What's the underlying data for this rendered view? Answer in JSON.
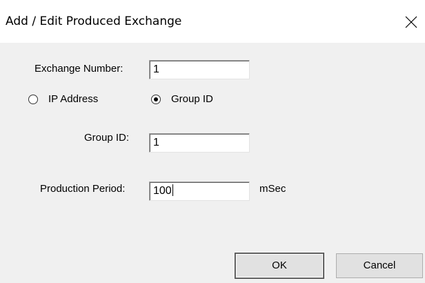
{
  "window": {
    "title": "Add / Edit Produced Exchange"
  },
  "exchange_number": {
    "label": "Exchange Number:",
    "value": "1"
  },
  "address_type": {
    "options": [
      {
        "label": "IP Address",
        "selected": false
      },
      {
        "label": "Group ID",
        "selected": true
      }
    ]
  },
  "group_id": {
    "label": "Group ID:",
    "value": "1"
  },
  "production_period": {
    "label": "Production Period:",
    "value": "100",
    "unit": "mSec"
  },
  "buttons": {
    "ok_label": "OK",
    "cancel_label": "Cancel"
  },
  "colors": {
    "dialog_background": "#f0f0f0",
    "titlebar_background": "#ffffff",
    "field_background": "#ffffff"
  },
  "icons": {
    "close": "close-icon"
  }
}
